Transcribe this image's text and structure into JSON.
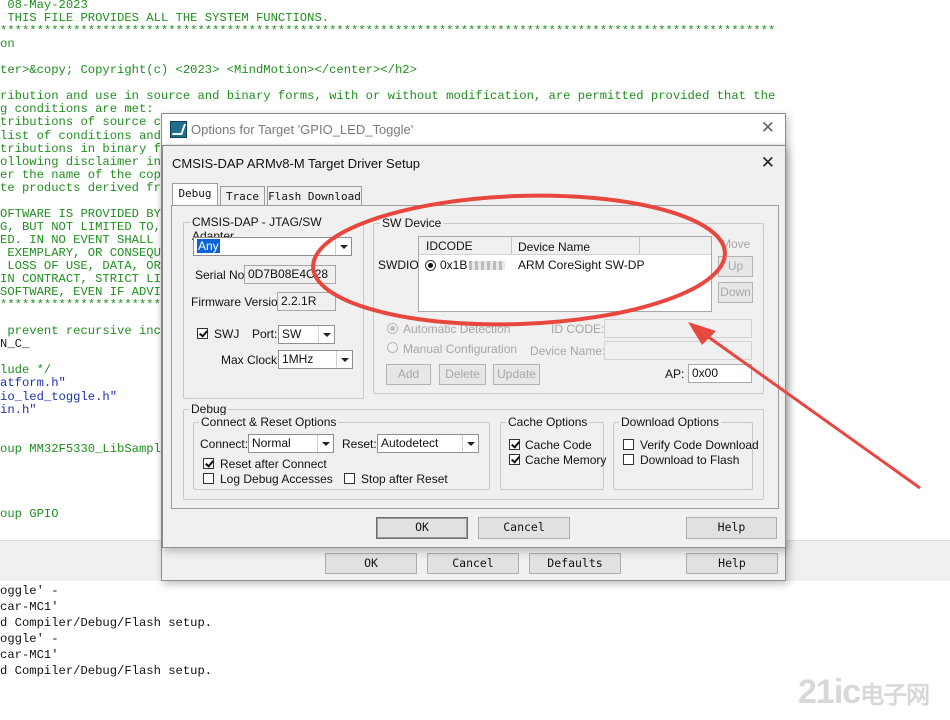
{
  "editor": {
    "lines": [
      {
        "text": " 08-May-2023",
        "cls": ""
      },
      {
        "text": " THIS FILE PROVIDES ALL THE SYSTEM FUNCTIONS.",
        "cls": ""
      },
      {
        "text": "**********************************************************************************************************",
        "cls": ""
      },
      {
        "text": "on",
        "cls": ""
      },
      {
        "text": "",
        "cls": ""
      },
      {
        "text": "ter>&copy; Copyright(c) <2023> <MindMotion></center></h2>",
        "cls": ""
      },
      {
        "text": "",
        "cls": ""
      },
      {
        "text": "ribution and use in source and binary forms, with or without modification, are permitted provided that the",
        "cls": ""
      },
      {
        "text": "g conditions are met:",
        "cls": ""
      },
      {
        "text": "tributions of source co",
        "cls": ""
      },
      {
        "text": "list of conditions and t",
        "cls": ""
      },
      {
        "text": "tributions in binary fo",
        "cls": ""
      },
      {
        "text": "ollowing disclaimer in t",
        "cls": ""
      },
      {
        "text": "er the name of the copy",
        "cls": ""
      },
      {
        "text": "te products derived from",
        "cls": ""
      },
      {
        "text": "",
        "cls": ""
      },
      {
        "text": "OFTWARE IS PROVIDED BY",
        "cls": ""
      },
      {
        "text": "G, BUT NOT LIMITED TO,",
        "cls": ""
      },
      {
        "text": "ED. IN NO EVENT SHALL T",
        "cls": ""
      },
      {
        "text": " EXEMPLARY, OR CONSEQUE",
        "cls": ""
      },
      {
        "text": " LOSS OF USE, DATA, OR",
        "cls": ""
      },
      {
        "text": "IN CONTRACT, STRICT LIA",
        "cls": ""
      },
      {
        "text": "SOFTWARE, EVEN IF ADVIS",
        "cls": ""
      },
      {
        "text": "**********************",
        "cls": ""
      },
      {
        "text": "",
        "cls": ""
      },
      {
        "text": " prevent recursive incl",
        "cls": ""
      },
      {
        "text": "N_C_",
        "cls": "code"
      },
      {
        "text": "",
        "cls": ""
      },
      {
        "text": "lude */",
        "cls": ""
      },
      {
        "text": "atform.h\"",
        "cls": "blue"
      },
      {
        "text": "io_led_toggle.h\"",
        "cls": "blue"
      },
      {
        "text": "in.h\"",
        "cls": "blue"
      },
      {
        "text": "",
        "cls": ""
      },
      {
        "text": "",
        "cls": ""
      },
      {
        "text": "oup MM32F5330_LibSample",
        "cls": ""
      },
      {
        "text": "",
        "cls": ""
      },
      {
        "text": "",
        "cls": ""
      },
      {
        "text": "",
        "cls": ""
      },
      {
        "text": "",
        "cls": ""
      },
      {
        "text": "oup GPIO",
        "cls": ""
      }
    ]
  },
  "build_output": [
    "oggle' -",
    "car-MC1'",
    "d Compiler/Debug/Flash setup.",
    "oggle' -",
    "car-MC1'",
    "d Compiler/Debug/Flash setup."
  ],
  "outer_dialog": {
    "title": "Options for Target 'GPIO_LED_Toggle'",
    "close": "✕",
    "buttons": {
      "ok": "OK",
      "cancel": "Cancel",
      "defaults": "Defaults",
      "help": "Help"
    }
  },
  "inner_dialog": {
    "title": "CMSIS-DAP ARMv8-M Target Driver Setup",
    "close": "✕",
    "tabs": [
      "Debug",
      "Trace",
      "Flash Download"
    ],
    "adapter": {
      "group_label": "CMSIS-DAP - JTAG/SW Adapter",
      "selected": "Any",
      "serial_label": "Serial No:",
      "serial_value": "0D7B08E4C28",
      "firmware_label": "Firmware Version:",
      "firmware_value": "2.2.1R",
      "swj_label": "SWJ",
      "port_label": "Port:",
      "port_value": "SW",
      "maxclock_label": "Max Clock:",
      "maxclock_value": "1MHz"
    },
    "sw_device": {
      "group_label": "SW Device",
      "swdio_label": "SWDIO",
      "col_idcode": "IDCODE",
      "col_device": "Device Name",
      "row_idcode": "0x1B",
      "row_device": "ARM CoreSight SW-DP",
      "move_label": "Move",
      "up_label": "Up",
      "down_label": "Down",
      "auto_detection": "Automatic Detection",
      "manual_config": "Manual Configuration",
      "id_code_label": "ID CODE:",
      "device_name_label": "Device Name:",
      "add": "Add",
      "delete": "Delete",
      "update": "Update",
      "ap_label": "AP:",
      "ap_value": "0x00"
    },
    "debug": {
      "group_label": "Debug",
      "connect_reset_label": "Connect & Reset Options",
      "connect_label": "Connect:",
      "connect_value": "Normal",
      "reset_label": "Reset:",
      "reset_value": "Autodetect",
      "reset_after_connect": "Reset after Connect",
      "log_debug": "Log Debug Accesses",
      "stop_after_reset": "Stop after Reset",
      "cache_label": "Cache Options",
      "cache_code": "Cache Code",
      "cache_memory": "Cache Memory",
      "download_label": "Download Options",
      "verify_code": "Verify Code Download",
      "download_flash": "Download to Flash"
    },
    "buttons": {
      "ok": "OK",
      "cancel": "Cancel",
      "help": "Help"
    }
  },
  "annotation_color": "#e8473f",
  "watermark": {
    "brand": "21ic",
    "cn": "电子网"
  }
}
